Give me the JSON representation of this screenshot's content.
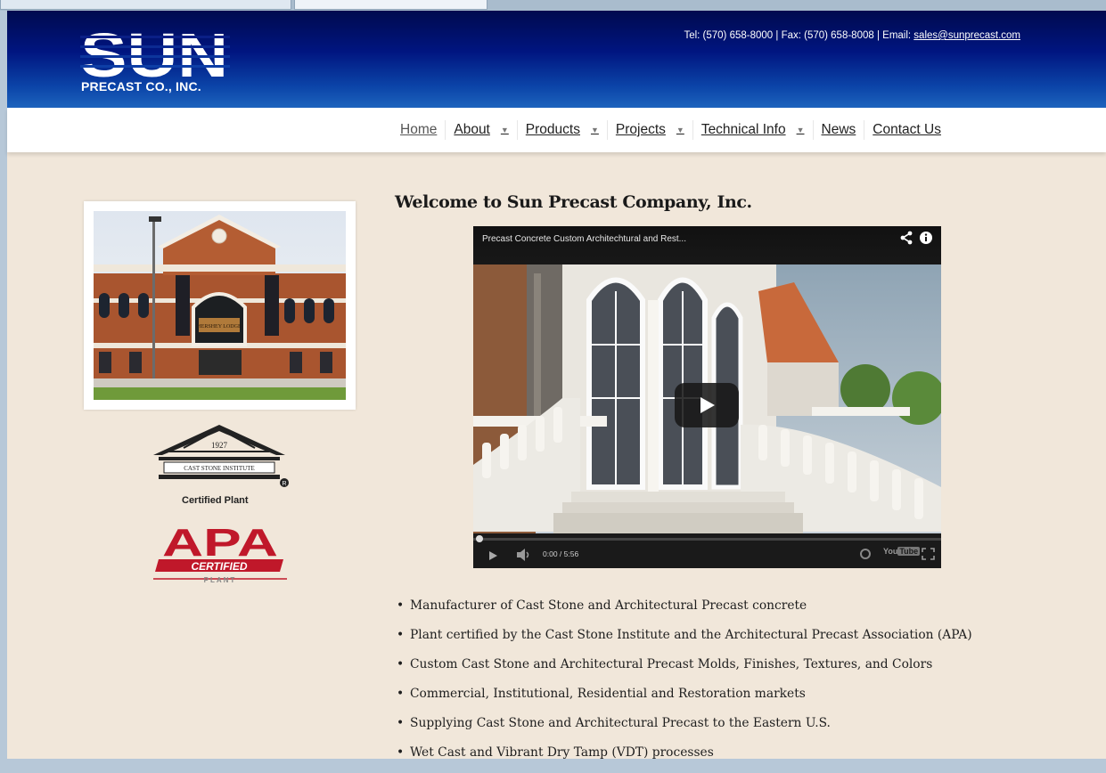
{
  "header": {
    "logo": {
      "wordmark": "SUN",
      "subtitle": "PRECAST CO., INC."
    },
    "contact": {
      "prefix": "Tel: (570) 658-8000 | Fax: (570) 658-8008 | Email:",
      "email": "sales@sunprecast.com"
    }
  },
  "nav": {
    "items": [
      {
        "label": "Home",
        "has_dropdown": false
      },
      {
        "label": "About",
        "has_dropdown": true
      },
      {
        "label": "Products",
        "has_dropdown": true
      },
      {
        "label": "Projects",
        "has_dropdown": true
      },
      {
        "label": "Technical Info",
        "has_dropdown": true
      },
      {
        "label": "News",
        "has_dropdown": false
      },
      {
        "label": "Contact Us",
        "has_dropdown": false
      }
    ]
  },
  "sidebar": {
    "photo_sign_text": "HERSHEY LODGE",
    "csi_logo": {
      "year": "1927",
      "name": "CAST STONE INSTITUTE"
    },
    "certified_label": "Certified Plant",
    "apa_logo": {
      "letters": "APA",
      "banner": "CERTIFIED",
      "footer": "PLANT"
    }
  },
  "main": {
    "title": "Welcome to Sun Precast Company, Inc.",
    "video": {
      "title": "Precast Concrete Custom Architechtural and Rest...",
      "time": "0:00 / 5:56",
      "progress_fraction": 0.0,
      "youtube_label_a": "You",
      "youtube_label_b": "Tube"
    },
    "features": [
      "Manufacturer of Cast Stone and Architectural Precast concrete",
      "Plant certified by the Cast Stone Institute and the Architectural Precast Association (APA)",
      "Custom Cast Stone and Architectural Precast Molds, Finishes, Textures, and Colors",
      "Commercial, Institutional, Residential and Restoration markets",
      "Supplying Cast Stone and Architectural Precast to the Eastern U.S.",
      "Wet Cast and Vibrant Dry Tamp (VDT) processes"
    ]
  },
  "colors": {
    "header_dark": "#000a4e",
    "header_light": "#1d63bd",
    "page_background": "#f1e7da",
    "apa_red": "#c0182a"
  }
}
